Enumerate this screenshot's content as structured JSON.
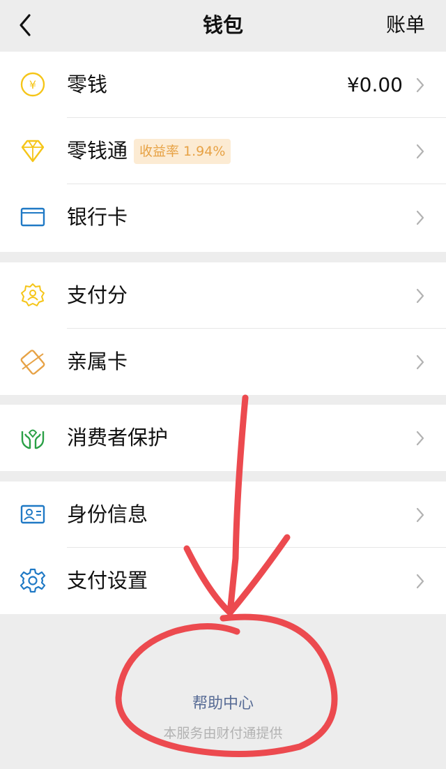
{
  "navbar": {
    "title": "钱包",
    "right_label": "账单"
  },
  "sections": [
    {
      "items": [
        {
          "id": "change",
          "label": "零钱",
          "value": "¥0.00",
          "icon": "yuan-circle-icon"
        },
        {
          "id": "lingqiantong",
          "label": "零钱通",
          "badge": "收益率 1.94%",
          "icon": "diamond-icon"
        },
        {
          "id": "bank-card",
          "label": "银行卡",
          "icon": "bank-card-icon"
        }
      ]
    },
    {
      "items": [
        {
          "id": "pay-score",
          "label": "支付分",
          "icon": "pay-score-badge-icon"
        },
        {
          "id": "family-card",
          "label": "亲属卡",
          "icon": "family-card-icon"
        }
      ]
    },
    {
      "items": [
        {
          "id": "consumer-protection",
          "label": "消费者保护",
          "icon": "protection-hands-icon"
        }
      ]
    },
    {
      "items": [
        {
          "id": "identity-info",
          "label": "身份信息",
          "icon": "id-card-icon"
        },
        {
          "id": "pay-settings",
          "label": "支付设置",
          "icon": "gear-icon"
        }
      ]
    }
  ],
  "footer": {
    "help_center": "帮助中心",
    "provider_note": "本服务由财付通提供"
  },
  "colors": {
    "background": "#ededed",
    "yellow_icon": "#f5c518",
    "orange_icon": "#e7a245",
    "blue_icon": "#1f79c5",
    "green_icon": "#2aa046",
    "annotation_red": "#ec4a4f",
    "link": "#576b95"
  }
}
